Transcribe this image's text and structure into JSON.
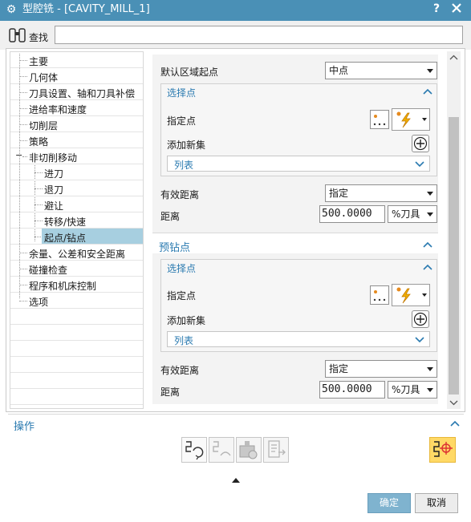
{
  "window": {
    "title": "型腔铣 - [CAVITY_MILL_1]",
    "help_label": "?",
    "close_label": "X",
    "accent_color": "#4a90b6"
  },
  "search": {
    "label": "查找",
    "value": ""
  },
  "tree": {
    "items": [
      {
        "label": "主要"
      },
      {
        "label": "几何体"
      },
      {
        "label": "刀具设置、轴和刀具补偿"
      },
      {
        "label": "进给率和速度"
      },
      {
        "label": "切削层"
      },
      {
        "label": "策略"
      },
      {
        "label": "非切削移动",
        "expander": "−"
      },
      {
        "label": "进刀"
      },
      {
        "label": "退刀"
      },
      {
        "label": "避让"
      },
      {
        "label": "转移/快速"
      },
      {
        "label": "起点/钻点",
        "selected": true
      },
      {
        "label": "余量、公差和安全距离"
      },
      {
        "label": "碰撞检查"
      },
      {
        "label": "程序和机床控制"
      },
      {
        "label": "选项"
      }
    ]
  },
  "region_start": {
    "default_start_label": "默认区域起点",
    "default_start_value": "中点",
    "select_point_header": "选择点",
    "specify_point_label": "指定点",
    "dots_label": "...",
    "add_set_label": "添加新集",
    "list_label": "列表",
    "effective_distance_label": "有效距离",
    "effective_distance_value": "指定",
    "distance_label": "距离",
    "distance_value": "500.0000",
    "distance_unit": "%刀具"
  },
  "predrill": {
    "header": "预钻点",
    "select_point_header": "选择点",
    "specify_point_label": "指定点",
    "dots_label": "...",
    "add_set_label": "添加新集",
    "list_label": "列表",
    "effective_distance_label": "有效距离",
    "effective_distance_value": "指定",
    "distance_label": "距离",
    "distance_value": "500.0000",
    "distance_unit": "%刀具"
  },
  "operations": {
    "title": "操作"
  },
  "footer": {
    "ok_label": "确定",
    "cancel_label": "取消"
  }
}
